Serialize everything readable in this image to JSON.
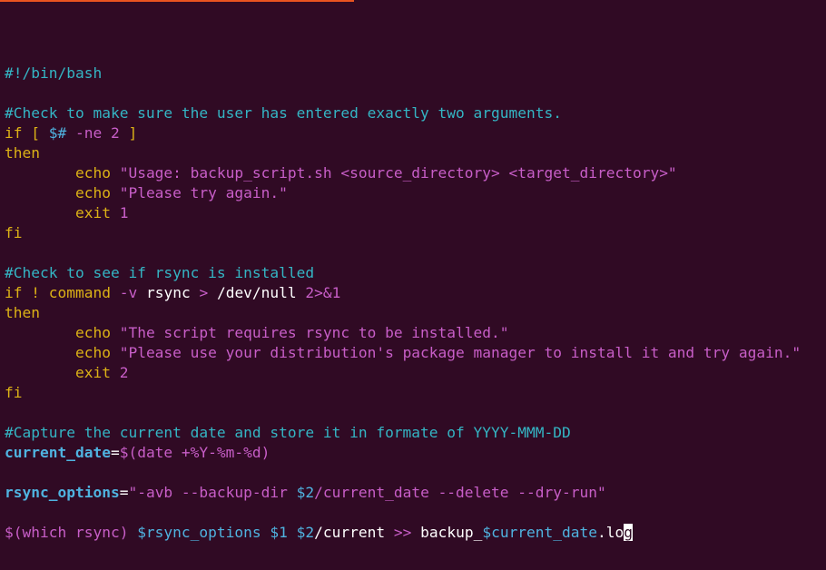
{
  "editor": {
    "lines": [
      [
        {
          "t": "#!/bin/bash",
          "c": "comment"
        }
      ],
      [],
      [
        {
          "t": "#Check to make sure the user has entered exactly two arguments.",
          "c": "comment"
        }
      ],
      [
        {
          "t": "if [ ",
          "c": "keyword"
        },
        {
          "t": "$#",
          "c": "variable"
        },
        {
          "t": " -ne ",
          "c": "option"
        },
        {
          "t": "2",
          "c": "number"
        },
        {
          "t": " ]",
          "c": "bracket"
        }
      ],
      [
        {
          "t": "then",
          "c": "keyword"
        }
      ],
      [
        {
          "t": "        ",
          "c": "plain"
        },
        {
          "t": "echo",
          "c": "command"
        },
        {
          "t": " ",
          "c": "plain"
        },
        {
          "t": "\"Usage: backup_script.sh <source_directory> <target_directory>\"",
          "c": "string"
        }
      ],
      [
        {
          "t": "        ",
          "c": "plain"
        },
        {
          "t": "echo",
          "c": "command"
        },
        {
          "t": " ",
          "c": "plain"
        },
        {
          "t": "\"Please try again.\"",
          "c": "string"
        }
      ],
      [
        {
          "t": "        ",
          "c": "plain"
        },
        {
          "t": "exit",
          "c": "command"
        },
        {
          "t": " ",
          "c": "plain"
        },
        {
          "t": "1",
          "c": "number"
        }
      ],
      [
        {
          "t": "fi",
          "c": "keyword"
        }
      ],
      [],
      [
        {
          "t": "#Check to see if rsync is installed",
          "c": "comment"
        }
      ],
      [
        {
          "t": "if ! ",
          "c": "keyword"
        },
        {
          "t": "command",
          "c": "command"
        },
        {
          "t": " -v",
          "c": "option"
        },
        {
          "t": " rsync ",
          "c": "plain"
        },
        {
          "t": ">",
          "c": "redirect"
        },
        {
          "t": " /dev/null ",
          "c": "plain"
        },
        {
          "t": "2>&1",
          "c": "redirect"
        }
      ],
      [
        {
          "t": "then",
          "c": "keyword"
        }
      ],
      [
        {
          "t": "        ",
          "c": "plain"
        },
        {
          "t": "echo",
          "c": "command"
        },
        {
          "t": " ",
          "c": "plain"
        },
        {
          "t": "\"The script requires rsync to be installed.\"",
          "c": "string"
        }
      ],
      [
        {
          "t": "        ",
          "c": "plain"
        },
        {
          "t": "echo",
          "c": "command"
        },
        {
          "t": " ",
          "c": "plain"
        },
        {
          "t": "\"Please use your distribution's package manager to install it and try again.\"",
          "c": "string"
        }
      ],
      [
        {
          "t": "        ",
          "c": "plain"
        },
        {
          "t": "exit",
          "c": "command"
        },
        {
          "t": " ",
          "c": "plain"
        },
        {
          "t": "2",
          "c": "number"
        }
      ],
      [
        {
          "t": "fi",
          "c": "keyword"
        }
      ],
      [],
      [
        {
          "t": "#Capture the current date and store it in formate of YYYY-MMM-DD",
          "c": "comment"
        }
      ],
      [
        {
          "t": "current_date",
          "c": "assign-name"
        },
        {
          "t": "=",
          "c": "plain"
        },
        {
          "t": "$(date +%Y-%m-%d)",
          "c": "string"
        }
      ],
      [],
      [
        {
          "t": "rsync_options",
          "c": "assign-name"
        },
        {
          "t": "=",
          "c": "plain"
        },
        {
          "t": "\"-avb --backup-dir ",
          "c": "string"
        },
        {
          "t": "$2",
          "c": "variable"
        },
        {
          "t": "/current_date --delete --dry-run\"",
          "c": "string"
        }
      ],
      [],
      [
        {
          "t": "$(which rsync) ",
          "c": "string"
        },
        {
          "t": "$rsync_options",
          "c": "variable"
        },
        {
          "t": " ",
          "c": "plain"
        },
        {
          "t": "$1",
          "c": "variable"
        },
        {
          "t": " ",
          "c": "plain"
        },
        {
          "t": "$2",
          "c": "variable"
        },
        {
          "t": "/current ",
          "c": "plain"
        },
        {
          "t": ">>",
          "c": "redirect"
        },
        {
          "t": " backup_",
          "c": "plain"
        },
        {
          "t": "$current_date",
          "c": "variable"
        },
        {
          "t": ".lo",
          "c": "plain"
        },
        {
          "t": "g",
          "c": "cursor"
        }
      ]
    ]
  },
  "colors": {
    "background": "#300a24",
    "accent": "#e95420",
    "comment": "#34b5c4",
    "keyword": "#dcb216",
    "string": "#c85ec8",
    "variable": "#4fb3e0",
    "plain": "#ffffff"
  }
}
